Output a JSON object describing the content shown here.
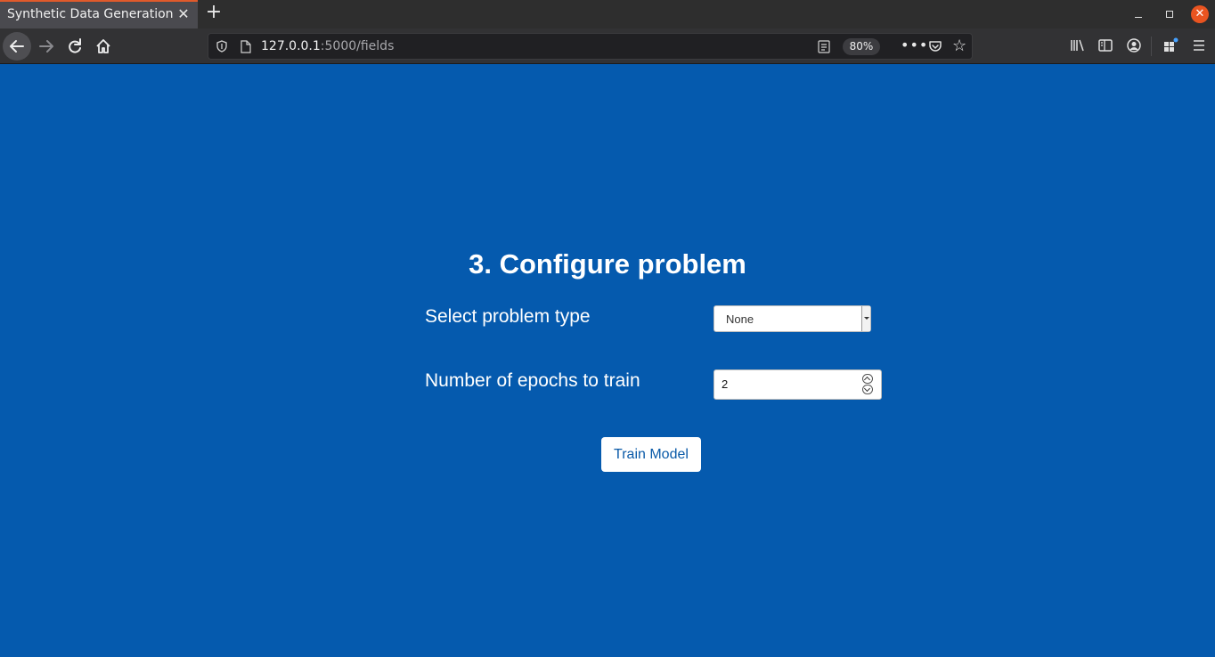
{
  "browser": {
    "tab_title": "Synthetic Data Generation",
    "tab_close": "✕",
    "new_tab": "+",
    "url_host": "127.0.0.1",
    "url_path": ":5000/fields",
    "zoom": "80%",
    "more": "•••",
    "star": "☆",
    "close_window": "✕"
  },
  "page": {
    "title": "3. Configure problem",
    "problem_type_label": "Select problem type",
    "problem_type_value": "None",
    "epochs_label": "Number of epochs to train",
    "epochs_value": "2",
    "train_button": "Train Model"
  },
  "colors": {
    "page_background": "#055aae",
    "button_text": "#0a5aa8",
    "tab_accent": "#e05a2b"
  }
}
